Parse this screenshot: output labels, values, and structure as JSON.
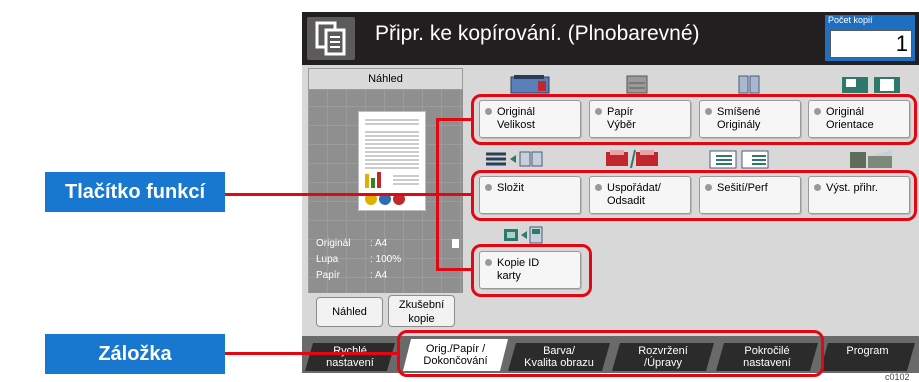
{
  "header": {
    "title": "Připr. ke kopírování. (Plnobarevné)",
    "copy_count_label": "Počet kopií",
    "copy_count_value": "1"
  },
  "preview": {
    "header_label": "Náhled",
    "info": [
      {
        "label": "Originál",
        "value": ": A4"
      },
      {
        "label": "Lupa",
        "value": ": 100%"
      },
      {
        "label": "Papír",
        "value": ": A4"
      }
    ],
    "preview_button": "Náhled",
    "test_copy_button_line1": "Zkušební",
    "test_copy_button_line2": "kopie"
  },
  "functions": {
    "row1": [
      {
        "l1": "Originál",
        "l2": "Velikost"
      },
      {
        "l1": "Papír",
        "l2": "Výběr"
      },
      {
        "l1": "Smíšené",
        "l2": "Originály"
      },
      {
        "l1": "Originál",
        "l2": "Orientace"
      }
    ],
    "row2": [
      {
        "l1": "Složit",
        "l2": ""
      },
      {
        "l1": "Uspořádat/",
        "l2": "Odsadit"
      },
      {
        "l1": "Sešití/Perf",
        "l2": ""
      },
      {
        "l1": "Výst. přihr.",
        "l2": ""
      }
    ],
    "row3": [
      {
        "l1": "Kopie ID",
        "l2": "karty"
      }
    ]
  },
  "tabs": [
    {
      "l1": "Rychlé",
      "l2": "nastavení"
    },
    {
      "l1": "Orig./Papír /",
      "l2": "Dokončování"
    },
    {
      "l1": "Barva/",
      "l2": "Kvalita obrazu"
    },
    {
      "l1": "Rozvržení",
      "l2": "/Úpravy"
    },
    {
      "l1": "Pokročilé",
      "l2": "nastavení"
    },
    {
      "l1": "Program",
      "l2": ""
    }
  ],
  "callouts": {
    "function_key": "Tlačítko funkcí",
    "tab": "Záložka"
  },
  "footnote": "c0102",
  "colors": {
    "highlight": "#e30613",
    "callout": "#1878d0",
    "titlebar": "#231f20",
    "copy_count_bg": "#1e6fbf"
  }
}
